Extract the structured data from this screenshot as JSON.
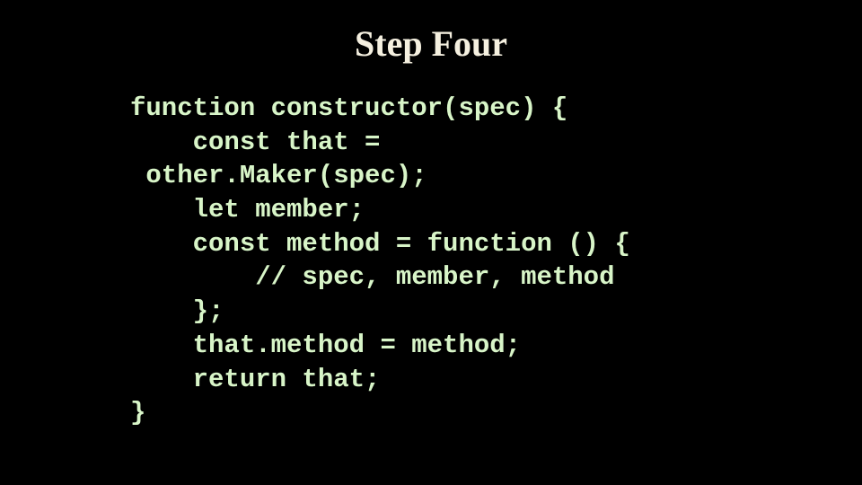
{
  "title": "Step Four",
  "code": {
    "line1": "function constructor(spec) {",
    "line2": "    const that =",
    "line3": " other.Maker(spec);",
    "line4": "    let member;",
    "line5": "    const method = function () {",
    "line6": "        // spec, member, method",
    "line7": "    };",
    "line8": "    that.method = method;",
    "line9": "    return that;",
    "line10": "}"
  }
}
